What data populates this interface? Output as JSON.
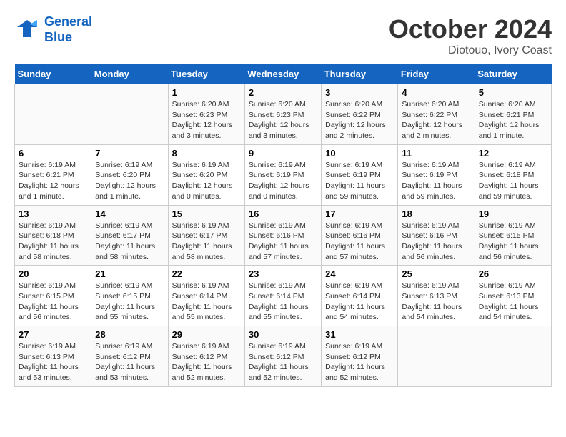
{
  "logo": {
    "line1": "General",
    "line2": "Blue"
  },
  "title": "October 2024",
  "location": "Diotouo, Ivory Coast",
  "days_of_week": [
    "Sunday",
    "Monday",
    "Tuesday",
    "Wednesday",
    "Thursday",
    "Friday",
    "Saturday"
  ],
  "weeks": [
    [
      {
        "day": "",
        "info": ""
      },
      {
        "day": "",
        "info": ""
      },
      {
        "day": "1",
        "info": "Sunrise: 6:20 AM\nSunset: 6:23 PM\nDaylight: 12 hours\nand 3 minutes."
      },
      {
        "day": "2",
        "info": "Sunrise: 6:20 AM\nSunset: 6:23 PM\nDaylight: 12 hours\nand 3 minutes."
      },
      {
        "day": "3",
        "info": "Sunrise: 6:20 AM\nSunset: 6:22 PM\nDaylight: 12 hours\nand 2 minutes."
      },
      {
        "day": "4",
        "info": "Sunrise: 6:20 AM\nSunset: 6:22 PM\nDaylight: 12 hours\nand 2 minutes."
      },
      {
        "day": "5",
        "info": "Sunrise: 6:20 AM\nSunset: 6:21 PM\nDaylight: 12 hours\nand 1 minute."
      }
    ],
    [
      {
        "day": "6",
        "info": "Sunrise: 6:19 AM\nSunset: 6:21 PM\nDaylight: 12 hours\nand 1 minute."
      },
      {
        "day": "7",
        "info": "Sunrise: 6:19 AM\nSunset: 6:20 PM\nDaylight: 12 hours\nand 1 minute."
      },
      {
        "day": "8",
        "info": "Sunrise: 6:19 AM\nSunset: 6:20 PM\nDaylight: 12 hours\nand 0 minutes."
      },
      {
        "day": "9",
        "info": "Sunrise: 6:19 AM\nSunset: 6:19 PM\nDaylight: 12 hours\nand 0 minutes."
      },
      {
        "day": "10",
        "info": "Sunrise: 6:19 AM\nSunset: 6:19 PM\nDaylight: 11 hours\nand 59 minutes."
      },
      {
        "day": "11",
        "info": "Sunrise: 6:19 AM\nSunset: 6:19 PM\nDaylight: 11 hours\nand 59 minutes."
      },
      {
        "day": "12",
        "info": "Sunrise: 6:19 AM\nSunset: 6:18 PM\nDaylight: 11 hours\nand 59 minutes."
      }
    ],
    [
      {
        "day": "13",
        "info": "Sunrise: 6:19 AM\nSunset: 6:18 PM\nDaylight: 11 hours\nand 58 minutes."
      },
      {
        "day": "14",
        "info": "Sunrise: 6:19 AM\nSunset: 6:17 PM\nDaylight: 11 hours\nand 58 minutes."
      },
      {
        "day": "15",
        "info": "Sunrise: 6:19 AM\nSunset: 6:17 PM\nDaylight: 11 hours\nand 58 minutes."
      },
      {
        "day": "16",
        "info": "Sunrise: 6:19 AM\nSunset: 6:16 PM\nDaylight: 11 hours\nand 57 minutes."
      },
      {
        "day": "17",
        "info": "Sunrise: 6:19 AM\nSunset: 6:16 PM\nDaylight: 11 hours\nand 57 minutes."
      },
      {
        "day": "18",
        "info": "Sunrise: 6:19 AM\nSunset: 6:16 PM\nDaylight: 11 hours\nand 56 minutes."
      },
      {
        "day": "19",
        "info": "Sunrise: 6:19 AM\nSunset: 6:15 PM\nDaylight: 11 hours\nand 56 minutes."
      }
    ],
    [
      {
        "day": "20",
        "info": "Sunrise: 6:19 AM\nSunset: 6:15 PM\nDaylight: 11 hours\nand 56 minutes."
      },
      {
        "day": "21",
        "info": "Sunrise: 6:19 AM\nSunset: 6:15 PM\nDaylight: 11 hours\nand 55 minutes."
      },
      {
        "day": "22",
        "info": "Sunrise: 6:19 AM\nSunset: 6:14 PM\nDaylight: 11 hours\nand 55 minutes."
      },
      {
        "day": "23",
        "info": "Sunrise: 6:19 AM\nSunset: 6:14 PM\nDaylight: 11 hours\nand 55 minutes."
      },
      {
        "day": "24",
        "info": "Sunrise: 6:19 AM\nSunset: 6:14 PM\nDaylight: 11 hours\nand 54 minutes."
      },
      {
        "day": "25",
        "info": "Sunrise: 6:19 AM\nSunset: 6:13 PM\nDaylight: 11 hours\nand 54 minutes."
      },
      {
        "day": "26",
        "info": "Sunrise: 6:19 AM\nSunset: 6:13 PM\nDaylight: 11 hours\nand 54 minutes."
      }
    ],
    [
      {
        "day": "27",
        "info": "Sunrise: 6:19 AM\nSunset: 6:13 PM\nDaylight: 11 hours\nand 53 minutes."
      },
      {
        "day": "28",
        "info": "Sunrise: 6:19 AM\nSunset: 6:12 PM\nDaylight: 11 hours\nand 53 minutes."
      },
      {
        "day": "29",
        "info": "Sunrise: 6:19 AM\nSunset: 6:12 PM\nDaylight: 11 hours\nand 52 minutes."
      },
      {
        "day": "30",
        "info": "Sunrise: 6:19 AM\nSunset: 6:12 PM\nDaylight: 11 hours\nand 52 minutes."
      },
      {
        "day": "31",
        "info": "Sunrise: 6:19 AM\nSunset: 6:12 PM\nDaylight: 11 hours\nand 52 minutes."
      },
      {
        "day": "",
        "info": ""
      },
      {
        "day": "",
        "info": ""
      }
    ]
  ]
}
